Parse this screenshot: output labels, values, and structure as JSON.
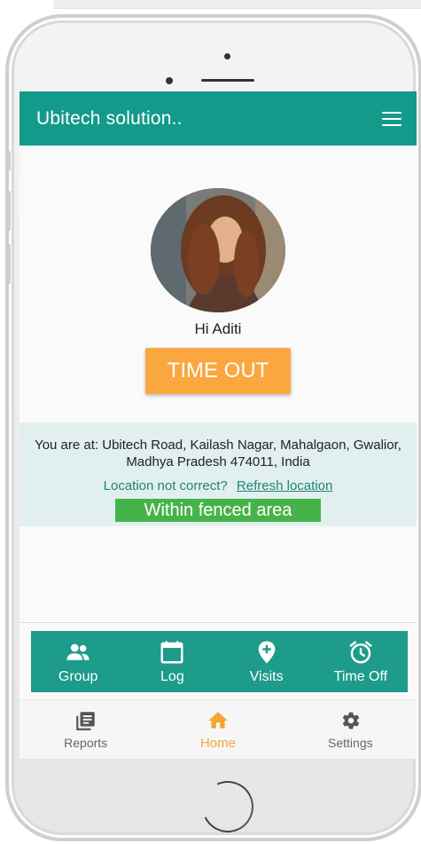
{
  "app": {
    "title": "Ubitech solution.."
  },
  "profile": {
    "greeting": "Hi Aditi"
  },
  "attendance": {
    "action_label": "TIME OUT"
  },
  "location": {
    "address": "You are at: Ubitech Road, Kailash Nagar, Mahalgaon, Gwalior, Madhya Pradesh 474011, India",
    "incorrect_prompt": "Location not correct?",
    "refresh_label": "Refresh location",
    "fence_status": "Within fenced area"
  },
  "actions": [
    {
      "label": "Group",
      "icon": "group-icon"
    },
    {
      "label": "Log",
      "icon": "calendar-icon"
    },
    {
      "label": "Visits",
      "icon": "location-add-icon"
    },
    {
      "label": "Time Off",
      "icon": "alarm-icon"
    }
  ],
  "bottom_nav": [
    {
      "label": "Reports",
      "icon": "reports-icon",
      "active": false
    },
    {
      "label": "Home",
      "icon": "home-icon",
      "active": true
    },
    {
      "label": "Settings",
      "icon": "settings-icon",
      "active": false
    }
  ],
  "colors": {
    "primary": "#149a8a",
    "accent": "#fba73f",
    "success": "#46b34a",
    "location_panel": "#e1efee"
  }
}
